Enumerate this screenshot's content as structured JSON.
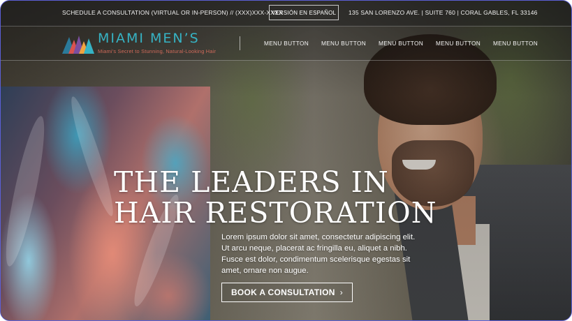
{
  "topbar": {
    "schedule_text": "SCHEDULE A CONSULTATION (VIRTUAL OR IN-PERSON) // (XXX)XXX-XXXX",
    "language_button": "VERSIÓN EN ESPAÑOL",
    "address": "135 SAN LORENZO AVE. | SUITE 760 | CORAL GABLES, FL 33146"
  },
  "brand": {
    "name": "MIAMI MEN’S",
    "tagline": "Miami's Secret to Stunning, Natural-Looking Hair",
    "logo_icon": "mountain-stripes-logo",
    "title_color": "#36b3c4",
    "tagline_color": "#d06a5a"
  },
  "nav": {
    "items": [
      {
        "label": "MENU BUTTON"
      },
      {
        "label": "MENU BUTTON"
      },
      {
        "label": "MENU BUTTON"
      },
      {
        "label": "MENU BUTTON"
      },
      {
        "label": "MENU BUTTON"
      }
    ]
  },
  "hero": {
    "title_line1": "THE LEADERS IN",
    "title_line2": "HAIR RESTORATION",
    "body": "Lorem ipsum dolor sit amet, consectetur adipiscing elit. Ut arcu neque, placerat ac fringilla eu, aliquet a nibh. Fusce est dolor, condimentum scelerisque egestas sit amet, ornare non augue.",
    "cta_label": "BOOK A CONSULTATION",
    "cta_icon": "chevron-right-icon"
  }
}
